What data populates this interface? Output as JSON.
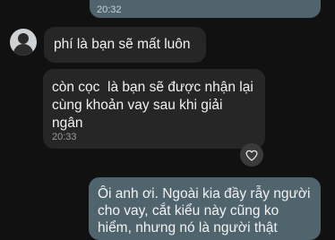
{
  "messages": [
    {
      "direction": "outgoing",
      "time": "20:32"
    },
    {
      "direction": "incoming",
      "text": "phí là bạn sẽ mất luôn"
    },
    {
      "direction": "incoming",
      "text": "còn cọc  là bạn sẽ được nhận lại cùng khoản vay sau khi giải ngân",
      "time": "20:33",
      "reaction_icon": "heart-icon"
    },
    {
      "direction": "outgoing",
      "text": "Ôi anh ơi. Ngoài kia đầy rẫy người cho vay, cắt kiểu này cũng ko hiểm, nhưng nó là người thật"
    }
  ],
  "colors": {
    "background": "#111111",
    "incoming_bubble": "#262626",
    "outgoing_bubble": "#50646e"
  }
}
